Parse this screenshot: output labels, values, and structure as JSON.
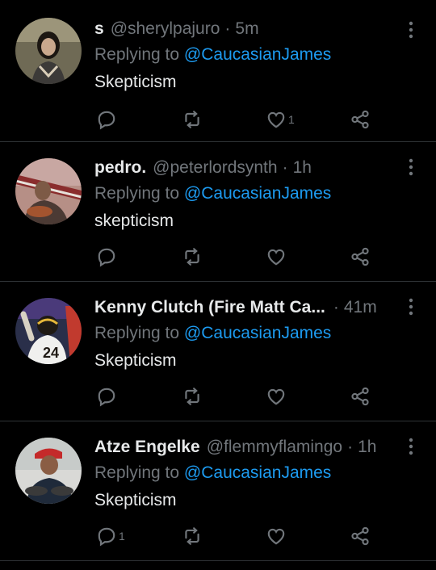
{
  "colors": {
    "background": "#000000",
    "text": "#e7e9ea",
    "muted": "#71767b",
    "link": "#1d9bf0",
    "divider": "#2f3336"
  },
  "tweets": [
    {
      "name": "s",
      "handle": "@sherylpajuro",
      "time": "5m",
      "replying_prefix": "Replying to",
      "replying_to": "@CaucasianJames",
      "text": "Skepticism",
      "reply_count": "",
      "like_count": "1"
    },
    {
      "name": "pedro.",
      "handle": "@peterlordsynth",
      "time": "1h",
      "replying_prefix": "Replying to",
      "replying_to": "@CaucasianJames",
      "text": "skepticism",
      "reply_count": "",
      "like_count": ""
    },
    {
      "name": "Kenny Clutch (Fire Matt Ca...",
      "handle": "",
      "time": "41m",
      "replying_prefix": "Replying to",
      "replying_to": "@CaucasianJames",
      "text": "Skepticism",
      "reply_count": "",
      "like_count": ""
    },
    {
      "name": "Atze Engelke",
      "handle": "@flemmyflamingo",
      "time": "1h",
      "replying_prefix": "Replying to",
      "replying_to": "@CaucasianJames",
      "text": "Skepticism",
      "reply_count": "1",
      "like_count": ""
    }
  ]
}
